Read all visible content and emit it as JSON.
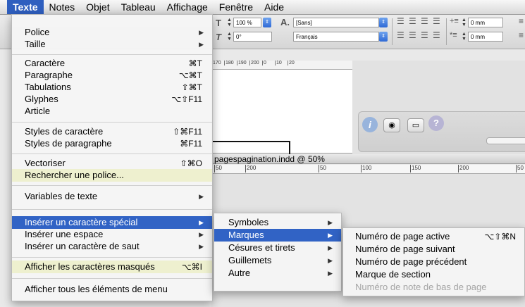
{
  "menubar": {
    "items": [
      "Texte",
      "Notes",
      "Objet",
      "Tableau",
      "Affichage",
      "Fenêtre",
      "Aide"
    ],
    "active_index": 0
  },
  "control_panel": {
    "font_size": "100 %",
    "angle": "0°",
    "font_name": "[Sans]",
    "language": "Français",
    "indent1": "0 mm",
    "indent2": "0 mm"
  },
  "doc1_ruler": [
    "170",
    "180",
    "190",
    "200",
    "0",
    "10",
    "20"
  ],
  "doc2": {
    "title": "pagespagination.indd @ 50%",
    "ruler": [
      "50",
      "200",
      "50",
      "100",
      "150",
      "200",
      "50"
    ]
  },
  "menu_texte": {
    "items": [
      {
        "label": "Police",
        "arrow": "▶"
      },
      {
        "label": "Taille",
        "arrow": "▶"
      },
      {
        "label": "Caractère",
        "shortcut": "⌘T"
      },
      {
        "label": "Paragraphe",
        "shortcut": "⌥⌘T"
      },
      {
        "label": "Tabulations",
        "shortcut": "⇧⌘T"
      },
      {
        "label": "Glyphes",
        "shortcut": "⌥⇧F11"
      },
      {
        "label": "Article"
      },
      {
        "label": "Styles de caractère",
        "shortcut": "⇧⌘F11"
      },
      {
        "label": "Styles de paragraphe",
        "shortcut": "⌘F11"
      },
      {
        "label": "Vectoriser",
        "shortcut": "⇧⌘O"
      },
      {
        "label": "Rechercher une police..."
      },
      {
        "label": "Variables de texte",
        "arrow": "▶"
      },
      {
        "label": "Insérer un caractère spécial",
        "arrow": "▶"
      },
      {
        "label": "Insérer une espace",
        "arrow": "▶"
      },
      {
        "label": "Insérer un caractère de saut",
        "arrow": "▶"
      },
      {
        "label": "Afficher les caractères masqués",
        "shortcut": "⌥⌘I"
      },
      {
        "label": "Afficher tous les éléments de menu"
      }
    ]
  },
  "menu_special": {
    "items": [
      {
        "label": "Symboles",
        "arrow": "▶"
      },
      {
        "label": "Marques",
        "arrow": "▶"
      },
      {
        "label": "Césures et tirets",
        "arrow": "▶"
      },
      {
        "label": "Guillemets",
        "arrow": "▶"
      },
      {
        "label": "Autre",
        "arrow": "▶"
      }
    ]
  },
  "menu_marques": {
    "items": [
      {
        "label": "Numéro de page active",
        "shortcut": "⌥⇧⌘N"
      },
      {
        "label": "Numéro de page suivant"
      },
      {
        "label": "Numéro de page précédent"
      },
      {
        "label": "Marque de section"
      },
      {
        "label": "Numéro de note de bas de page"
      }
    ]
  }
}
